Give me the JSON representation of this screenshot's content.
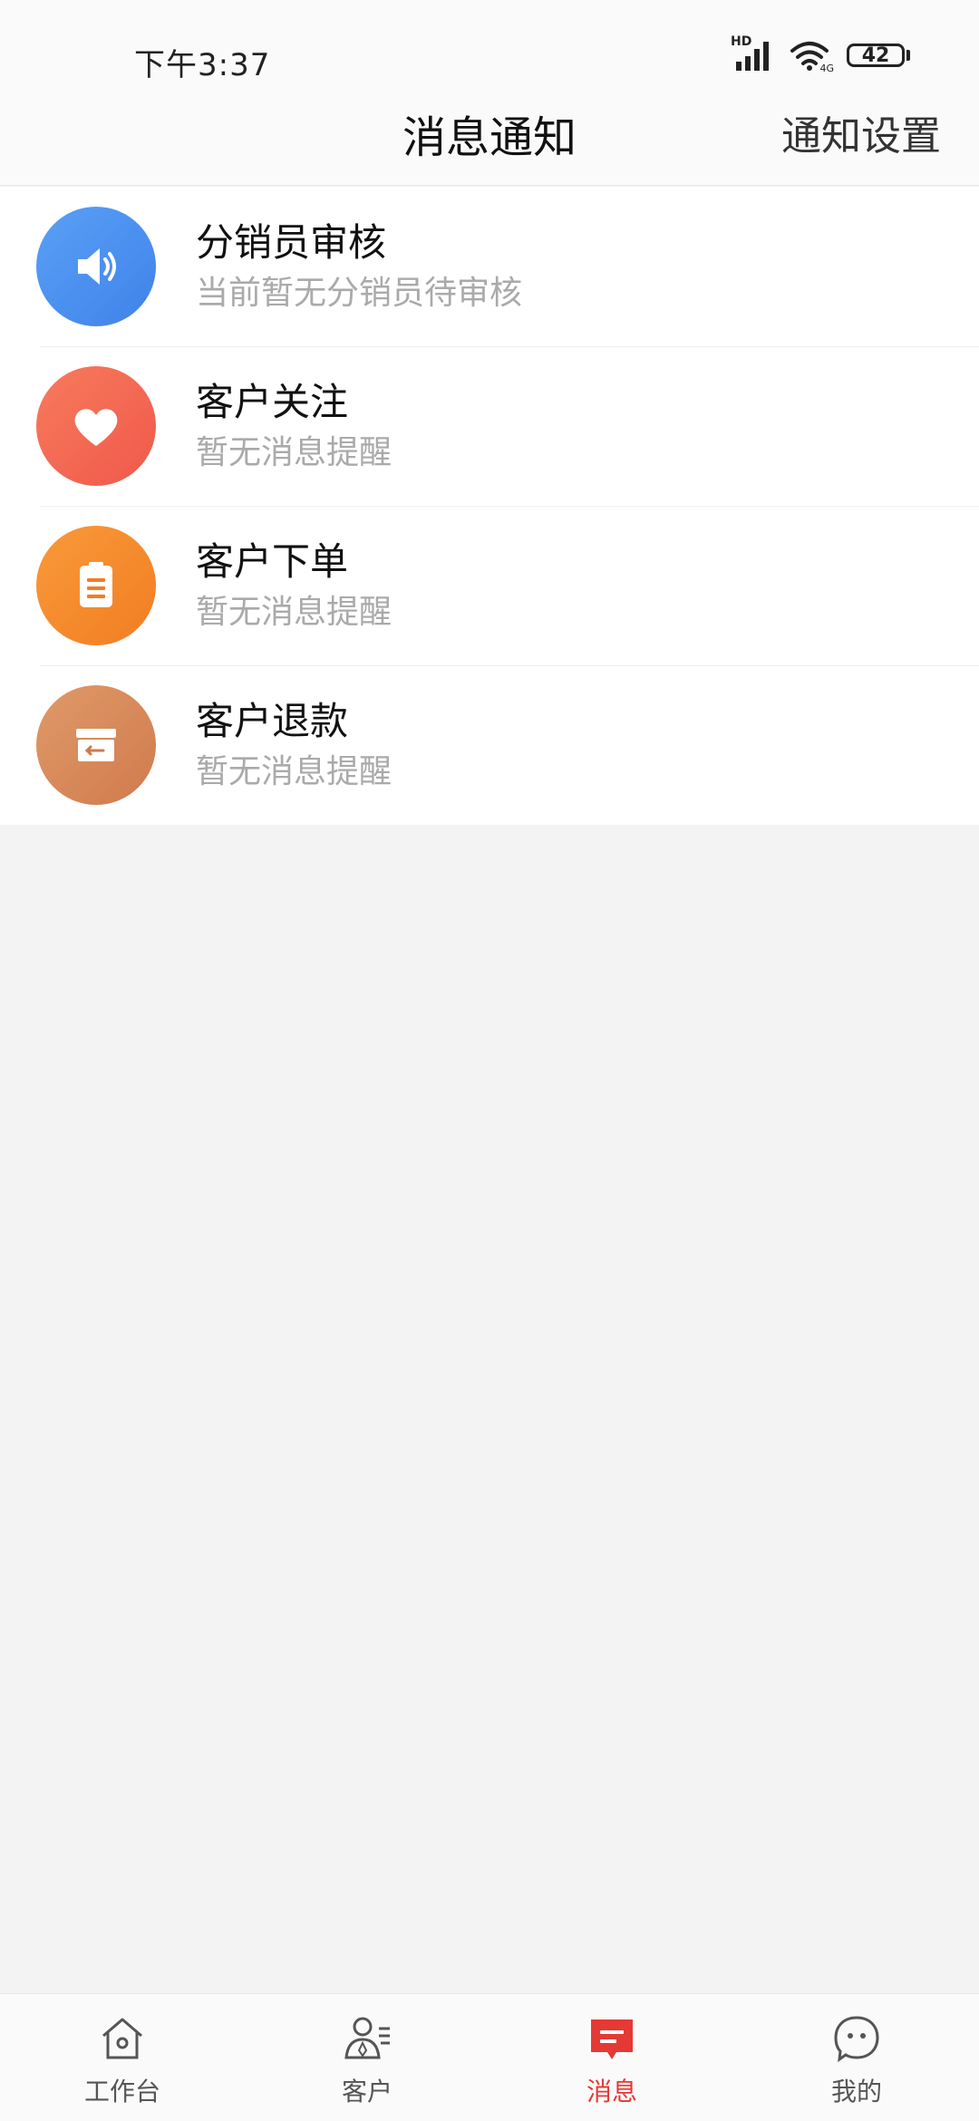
{
  "status_bar": {
    "time": "下午3:37",
    "battery": "42",
    "network_label": "HD",
    "network_small": "4G"
  },
  "header": {
    "title": "消息通知",
    "action": "通知设置"
  },
  "notifications": [
    {
      "title": "分销员审核",
      "subtitle": "当前暂无分销员待审核",
      "icon": "speaker-icon",
      "color": "#4a90f0"
    },
    {
      "title": "客户关注",
      "subtitle": "暂无消息提醒",
      "icon": "heart-icon",
      "color": "#f46a55"
    },
    {
      "title": "客户下单",
      "subtitle": "暂无消息提醒",
      "icon": "clipboard-icon",
      "color": "#f58a2a"
    },
    {
      "title": "客户退款",
      "subtitle": "暂无消息提醒",
      "icon": "refund-box-icon",
      "color": "#d88a5a"
    }
  ],
  "tabs": [
    {
      "label": "工作台",
      "icon": "home-icon",
      "active": false
    },
    {
      "label": "客户",
      "icon": "customer-icon",
      "active": false
    },
    {
      "label": "消息",
      "icon": "message-icon",
      "active": true
    },
    {
      "label": "我的",
      "icon": "profile-face-icon",
      "active": false
    }
  ],
  "colors": {
    "accent": "#e53935",
    "background": "#f3f3f3"
  }
}
